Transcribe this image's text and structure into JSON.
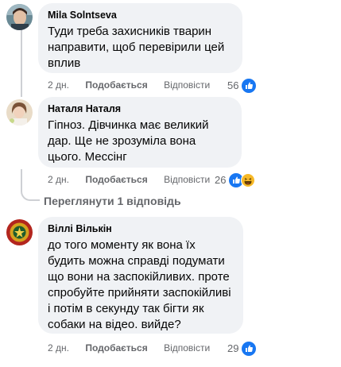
{
  "comments": [
    {
      "author": "Mila Solntseva",
      "text": "Туди треба захисників тварин направити, щоб перевірили цей вплив",
      "time": "2 дн.",
      "like_label": "Подобається",
      "reply_label": "Відповісти",
      "reaction_count": "56",
      "reactions": [
        "like-icon"
      ]
    },
    {
      "author": "Наталя Наталя",
      "text": "Гіпноз. Дівчинка має великий дар. Ще не зрозуміла вона цього. Мессінг",
      "time": "2 дн.",
      "like_label": "Подобається",
      "reply_label": "Відповісти",
      "reaction_count": "26",
      "reactions": [
        "like-icon",
        "haha-icon"
      ]
    },
    {
      "author": "Віллі Вількін",
      "text": "до того моменту як вона їх будить можна справді подумати що вони на заспокійливих. проте спробуйте прийняти заспокійливі і потім в секунду так бігти як собаки на відео. вийде?",
      "time": "2 дн.",
      "like_label": "Подобається",
      "reply_label": "Відповісти",
      "reaction_count": "29",
      "reactions": [
        "like-icon"
      ]
    }
  ],
  "view_replies_label": "Переглянути 1 відповідь",
  "colors": {
    "bubble": "#f0f2f5",
    "meta_text": "#65676b",
    "like_blue": "#1877f2",
    "haha_yellow": "#f7b928"
  }
}
